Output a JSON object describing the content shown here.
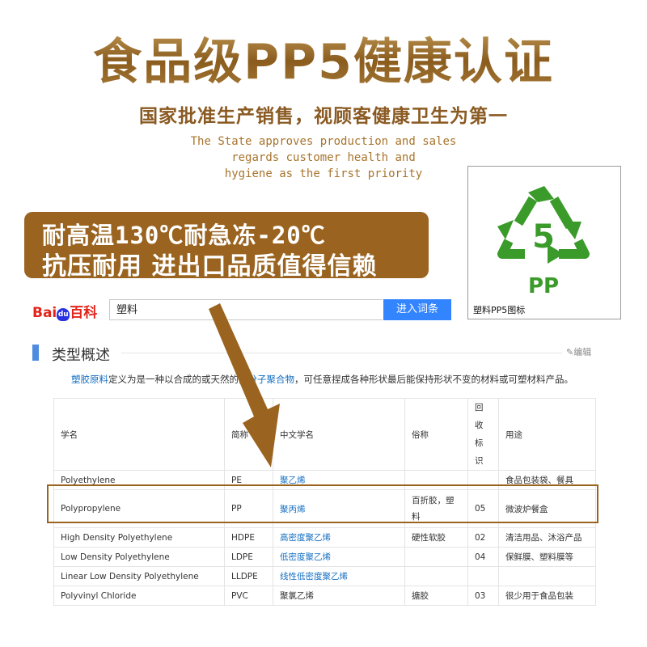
{
  "headline": {
    "title": "食品级PP5健康认证",
    "subtitle": "国家批准生产销售，视顾客健康卫生为第一",
    "english": [
      "The State approves production and sales",
      "regards customer health and",
      "hygiene as the first priority"
    ]
  },
  "banner": {
    "line1": "耐高温130℃耐急冻-20℃",
    "line2": "抗压耐用 进出口品质值得信赖"
  },
  "recycle_icon": {
    "number": "5",
    "code": "PP",
    "caption": "塑料PP5图标",
    "icon": "recycle-triangle-icon",
    "color": "#3a9a2a"
  },
  "baidu": {
    "logo_part1": "Bai",
    "logo_paw": "du",
    "logo_part2": "百科",
    "search_value": "塑料",
    "search_button": "进入词条"
  },
  "section": {
    "title": "类型概述",
    "edit": "编辑",
    "description_link1": "塑胶原料",
    "description_mid": "定义为是一种以合成的或天然的",
    "description_link2": "高分子聚合物",
    "description_tail": "，可任意捏成各种形状最后能保持形状不变的材料或可塑材料产品。"
  },
  "table": {
    "headers": [
      "学名",
      "简称",
      "中文学名",
      "俗称",
      "回收标识",
      "用途"
    ],
    "recycle_header_chars": [
      "回",
      "收",
      "标",
      "识"
    ],
    "rows": [
      {
        "name": "Polyethylene",
        "abbr": "PE",
        "cn": "聚乙烯",
        "common": "",
        "code": "",
        "use": "食品包装袋、餐具"
      },
      {
        "name": "Polypropylene",
        "abbr": "PP",
        "cn": "聚丙烯",
        "common": "百折胶，塑料",
        "code": "05",
        "use": "微波炉餐盒"
      },
      {
        "name": "High Density Polyethylene",
        "abbr": "HDPE",
        "cn": "高密度聚乙烯",
        "common": "硬性软胶",
        "code": "02",
        "use": "清洁用品、沐浴产品"
      },
      {
        "name": "Low Density Polyethylene",
        "abbr": "LDPE",
        "cn": "低密度聚乙烯",
        "common": "",
        "code": "04",
        "use": "保鲜膜、塑料膜等"
      },
      {
        "name": "Linear Low Density Polyethylene",
        "abbr": "LLDPE",
        "cn": "线性低密度聚乙烯",
        "common": "",
        "code": "",
        "use": ""
      },
      {
        "name": "Polyvinyl Chloride",
        "abbr": "PVC",
        "cn": "聚氯乙烯",
        "common": "搪胶",
        "code": "03",
        "use": "很少用于食品包装"
      }
    ]
  },
  "colors": {
    "brown": "#9a6420",
    "baidu_blue": "#3385ff",
    "link_blue": "#136ec2",
    "recycle_green": "#3a9a2a"
  }
}
